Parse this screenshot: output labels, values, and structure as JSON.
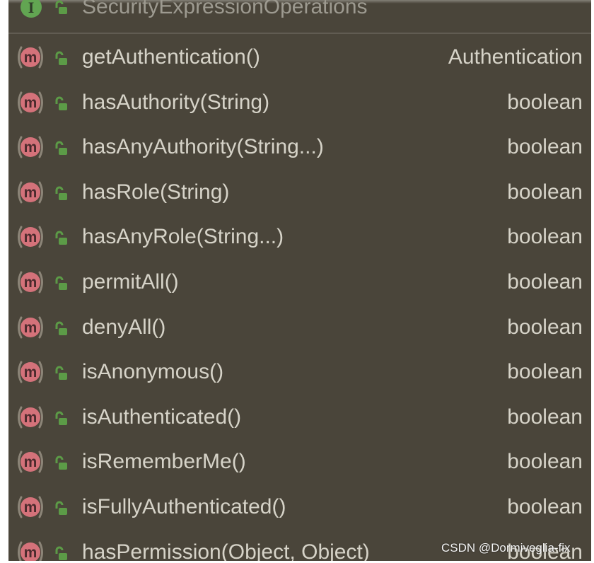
{
  "popup": {
    "header": {
      "title": "SecurityExpressionOperations",
      "icon": "interface-icon",
      "icon_letter": "I",
      "visibility_icon": "public-lock-icon"
    },
    "method_icon": {
      "icon": "method-icon",
      "letter": "m"
    },
    "visibility_icon": "public-lock-icon",
    "methods": [
      {
        "name": "getAuthentication()",
        "return_type": "Authentication"
      },
      {
        "name": "hasAuthority(String)",
        "return_type": "boolean"
      },
      {
        "name": "hasAnyAuthority(String...)",
        "return_type": "boolean"
      },
      {
        "name": "hasRole(String)",
        "return_type": "boolean"
      },
      {
        "name": "hasAnyRole(String...)",
        "return_type": "boolean"
      },
      {
        "name": "permitAll()",
        "return_type": "boolean"
      },
      {
        "name": "denyAll()",
        "return_type": "boolean"
      },
      {
        "name": "isAnonymous()",
        "return_type": "boolean"
      },
      {
        "name": "isAuthenticated()",
        "return_type": "boolean"
      },
      {
        "name": "isRememberMe()",
        "return_type": "boolean"
      },
      {
        "name": "isFullyAuthenticated()",
        "return_type": "boolean"
      },
      {
        "name": "hasPermission(Object, Object)",
        "return_type": "boolean"
      }
    ]
  },
  "watermark": "CSDN @Dormiveglia-fix",
  "colors": {
    "background": "#4a453a",
    "text": "#d6d3c8",
    "header_text": "#9d9a90",
    "method_icon": "#d4727a",
    "visibility_icon": "#5c9b47",
    "interface_icon": "#62a552"
  }
}
